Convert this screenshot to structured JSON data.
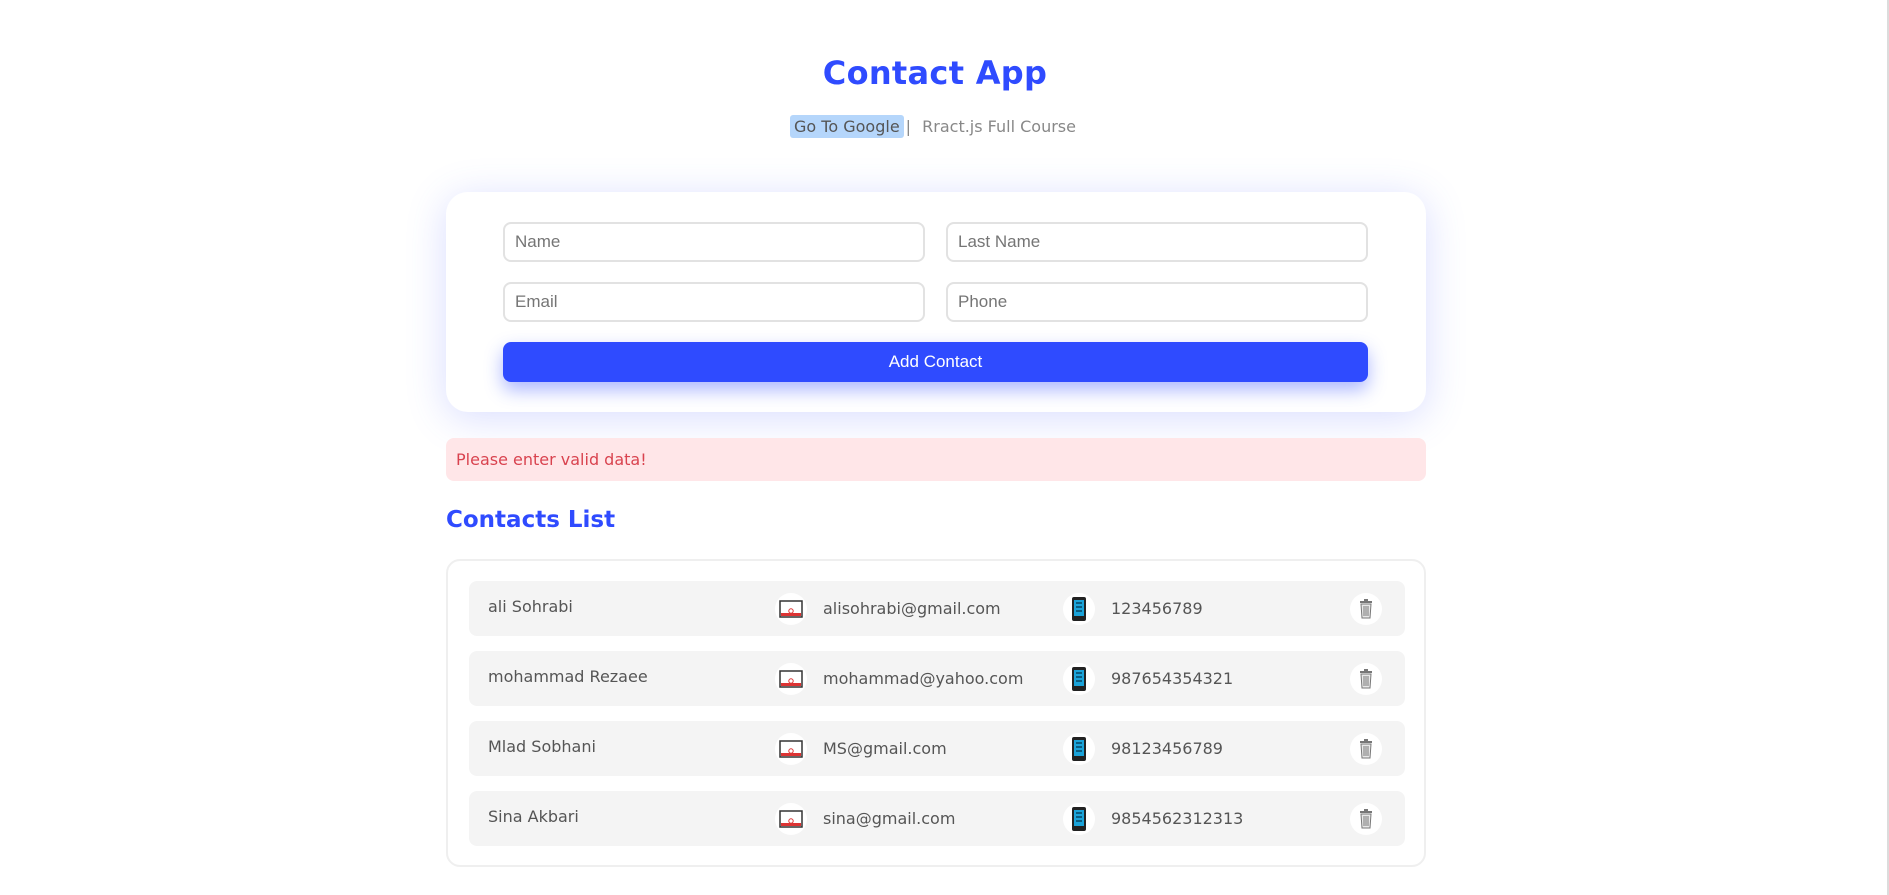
{
  "header": {
    "title": "Contact App",
    "nav": {
      "link_google": "Go To Google",
      "separator": "|",
      "link_course": "Rract.js Full Course"
    }
  },
  "form": {
    "name_placeholder": "Name",
    "last_name_placeholder": "Last Name",
    "email_placeholder": "Email",
    "phone_placeholder": "Phone",
    "name_value": "",
    "last_name_value": "",
    "email_value": "",
    "phone_value": "",
    "submit_label": "Add Contact"
  },
  "error": {
    "message": "Please enter valid data!"
  },
  "contacts": {
    "title": "Contacts List",
    "items": [
      {
        "name": "ali Sohrabi",
        "email": "alisohrabi@gmail.com",
        "phone": "123456789"
      },
      {
        "name": "mohammad Rezaee",
        "email": "mohammad@yahoo.com",
        "phone": "987654354321"
      },
      {
        "name": "Mlad Sobhani",
        "email": "MS@gmail.com",
        "phone": "98123456789"
      },
      {
        "name": "Sina Akbari",
        "email": "sina@gmail.com",
        "phone": "9854562312313"
      }
    ]
  },
  "icons": {
    "email": "envelope-icon",
    "phone": "mobile-phone-icon",
    "delete": "trash-icon"
  },
  "colors": {
    "accent": "#2f4bff",
    "error_bg": "#ffe6e8",
    "error_text": "#d9434f",
    "row_bg": "#f4f4f4"
  }
}
